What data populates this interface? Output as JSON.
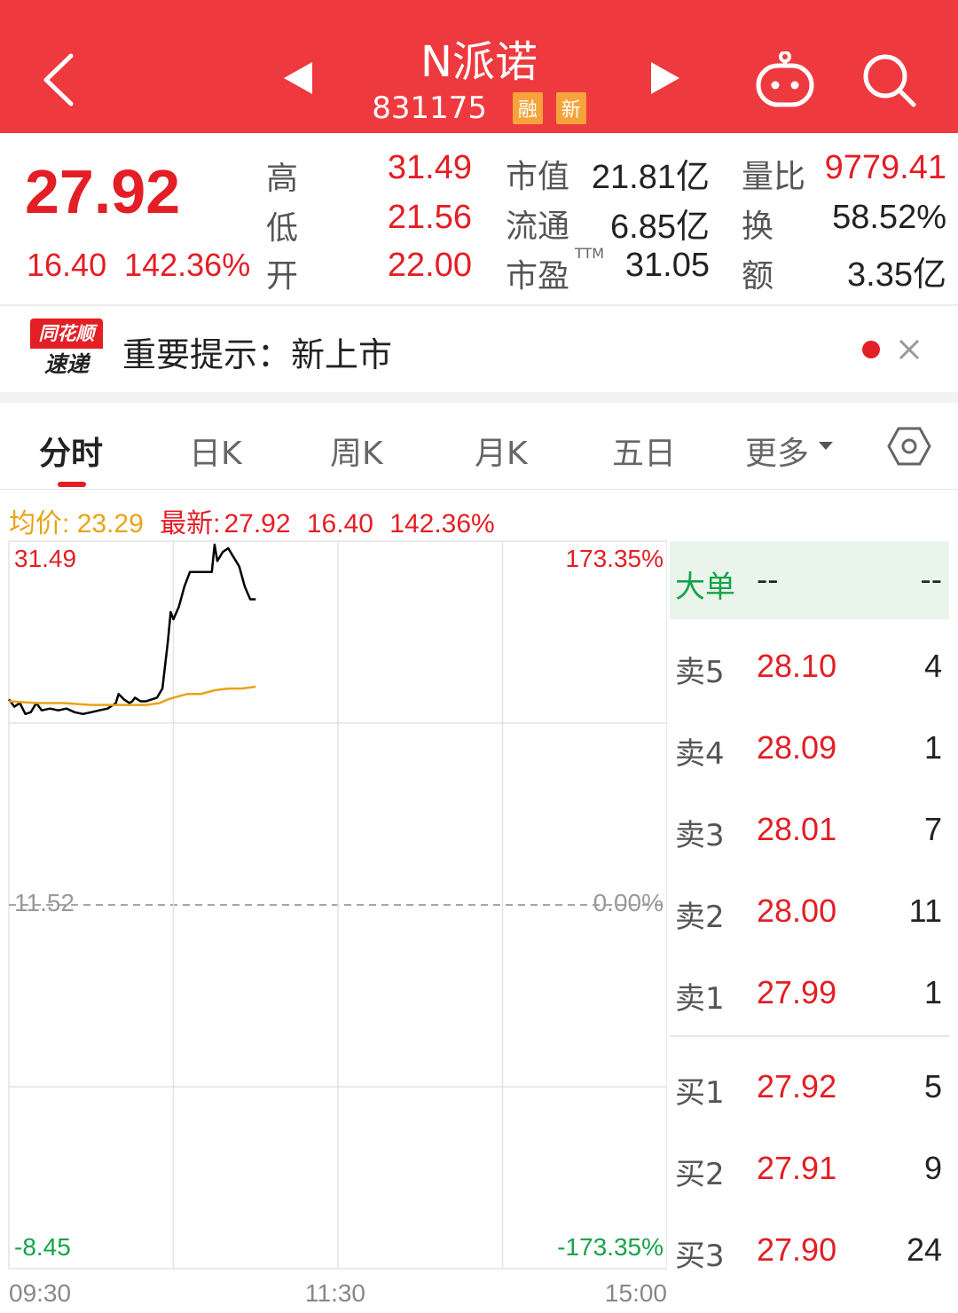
{
  "header": {
    "title": "N派诺",
    "code": "831175",
    "badges": [
      "融",
      "新"
    ],
    "icons": [
      "back-arrow-icon",
      "prev-triangle-icon",
      "next-triangle-icon",
      "robot-icon",
      "search-icon"
    ]
  },
  "quote": {
    "price": "27.92",
    "change": "16.40",
    "change_pct": "142.36%",
    "high_label": "高",
    "high": "31.49",
    "low_label": "低",
    "low": "21.56",
    "open_label": "开",
    "open": "22.00",
    "mktcap_label": "市值",
    "mktcap": "21.81亿",
    "float_label": "流通",
    "float": "6.85亿",
    "pe_label": "市盈",
    "pe_sup": "TTM",
    "pe": "31.05",
    "vol_ratio_label": "量比",
    "vol_ratio": "9779.41",
    "turnover_label": "换",
    "turnover": "58.52%",
    "amount_label": "额",
    "amount": "3.35亿"
  },
  "notice": {
    "logo_top": "同花顺",
    "logo_bottom": "速递",
    "text": "重要提示：新上市"
  },
  "tabs": {
    "items": [
      "分时",
      "日K",
      "周K",
      "月K",
      "五日",
      "更多"
    ],
    "active": "分时"
  },
  "info_line": {
    "avg_label": "均价:",
    "avg": "23.29",
    "latest_label": "最新:",
    "latest": "27.92",
    "change": "16.40",
    "change_pct": "142.36%"
  },
  "chart_data": {
    "type": "line",
    "y_left_top": "31.49",
    "y_left_mid": "11.52",
    "y_left_bottom": "-8.45",
    "y_right_top": "173.35%",
    "y_right_mid": "0.00%",
    "y_right_bottom": "-173.35%",
    "x_ticks": [
      "09:30",
      "11:30",
      "15:00"
    ],
    "ylim": [
      -8.45,
      31.49
    ],
    "series": [
      {
        "name": "最新",
        "color": "#000000",
        "x": [
          0,
          2,
          4,
          6,
          8,
          10,
          12,
          15,
          18,
          21,
          24,
          27,
          30,
          33,
          36,
          39,
          40,
          42,
          44,
          45,
          46,
          48,
          50,
          52,
          54,
          56,
          58,
          59,
          60,
          62,
          64,
          66,
          67,
          68,
          70,
          72,
          74,
          75,
          76,
          78,
          80,
          82,
          84,
          86,
          88,
          90
        ],
        "values": [
          22.8,
          22.4,
          22.6,
          22.0,
          22.1,
          22.6,
          22.2,
          22.3,
          22.2,
          22.3,
          22.1,
          22.0,
          22.1,
          22.2,
          22.3,
          22.6,
          23.1,
          22.8,
          22.6,
          22.7,
          22.9,
          22.7,
          22.7,
          22.8,
          22.9,
          23.4,
          26.0,
          27.6,
          27.2,
          27.9,
          29.0,
          29.8,
          29.8,
          29.8,
          29.8,
          29.8,
          29.8,
          31.3,
          30.4,
          30.9,
          31.1,
          30.6,
          30.1,
          29.0,
          28.3,
          28.3
        ]
      },
      {
        "name": "均价",
        "color": "#e8a317",
        "x": [
          0,
          10,
          20,
          30,
          40,
          50,
          55,
          58,
          60,
          65,
          70,
          75,
          80,
          85,
          90
        ],
        "values": [
          22.7,
          22.6,
          22.6,
          22.5,
          22.5,
          22.5,
          22.6,
          22.8,
          22.9,
          23.1,
          23.1,
          23.3,
          23.4,
          23.4,
          23.5
        ]
      }
    ]
  },
  "order_book": {
    "big_order_label": "大单",
    "big_order_v1": "--",
    "big_order_v2": "--",
    "asks": [
      {
        "label": "卖5",
        "price": "28.10",
        "vol": "4"
      },
      {
        "label": "卖4",
        "price": "28.09",
        "vol": "1"
      },
      {
        "label": "卖3",
        "price": "28.01",
        "vol": "7"
      },
      {
        "label": "卖2",
        "price": "28.00",
        "vol": "11"
      },
      {
        "label": "卖1",
        "price": "27.99",
        "vol": "1"
      }
    ],
    "bids": [
      {
        "label": "买1",
        "price": "27.92",
        "vol": "5"
      },
      {
        "label": "买2",
        "price": "27.91",
        "vol": "9"
      },
      {
        "label": "买3",
        "price": "27.90",
        "vol": "24"
      }
    ]
  }
}
